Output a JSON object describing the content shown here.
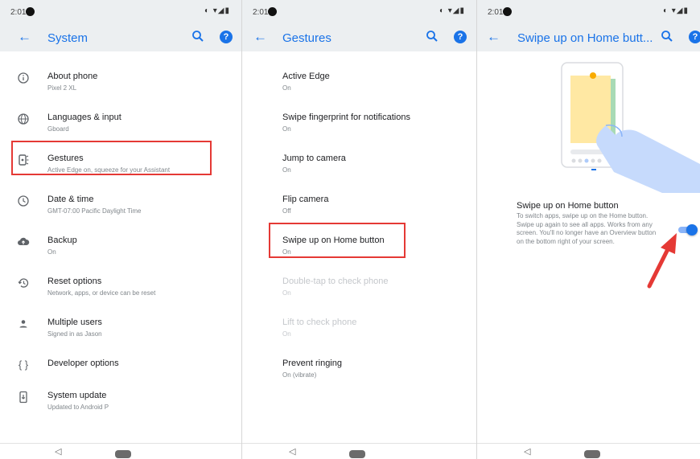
{
  "colors": {
    "accent": "#1a73e8",
    "highlight": "#e53935",
    "appbar": "#eceff1"
  },
  "panels": [
    {
      "status_time": "2:01",
      "title": "System",
      "items": [
        {
          "icon": "info-icon",
          "title": "About phone",
          "subtitle": "Pixel 2 XL"
        },
        {
          "icon": "globe-icon",
          "title": "Languages & input",
          "subtitle": "Gboard"
        },
        {
          "icon": "gestures-icon",
          "title": "Gestures",
          "subtitle": "Active Edge on, squeeze for your Assistant"
        },
        {
          "icon": "clock-icon",
          "title": "Date & time",
          "subtitle": "GMT-07:00 Pacific Daylight Time"
        },
        {
          "icon": "cloud-upload-icon",
          "title": "Backup",
          "subtitle": "On"
        },
        {
          "icon": "restore-icon",
          "title": "Reset options",
          "subtitle": "Network, apps, or device can be reset"
        },
        {
          "icon": "person-icon",
          "title": "Multiple users",
          "subtitle": "Signed in as Jason"
        },
        {
          "icon": "code-braces-icon",
          "title": "Developer options",
          "subtitle": ""
        },
        {
          "icon": "system-update-icon",
          "title": "System update",
          "subtitle": "Updated to Android P"
        }
      ]
    },
    {
      "status_time": "2:01",
      "title": "Gestures",
      "items": [
        {
          "title": "Active Edge",
          "subtitle": "On"
        },
        {
          "title": "Swipe fingerprint for notifications",
          "subtitle": "On"
        },
        {
          "title": "Jump to camera",
          "subtitle": "On"
        },
        {
          "title": "Flip camera",
          "subtitle": "Off"
        },
        {
          "title": "Swipe up on Home button",
          "subtitle": "On"
        },
        {
          "title": "Double-tap to check phone",
          "subtitle": "On"
        },
        {
          "title": "Lift to check phone",
          "subtitle": "On"
        },
        {
          "title": "Prevent ringing",
          "subtitle": "On (vibrate)"
        }
      ]
    },
    {
      "status_time": "2:01",
      "title": "Swipe up on Home butt...",
      "setting_title": "Swipe up on Home button",
      "setting_desc": "To switch apps, swipe up on the Home button. Swipe up again to see all apps. Works from any screen. You'll no longer have an Overview button on the bottom right of your screen.",
      "toggle_on": true
    }
  ]
}
